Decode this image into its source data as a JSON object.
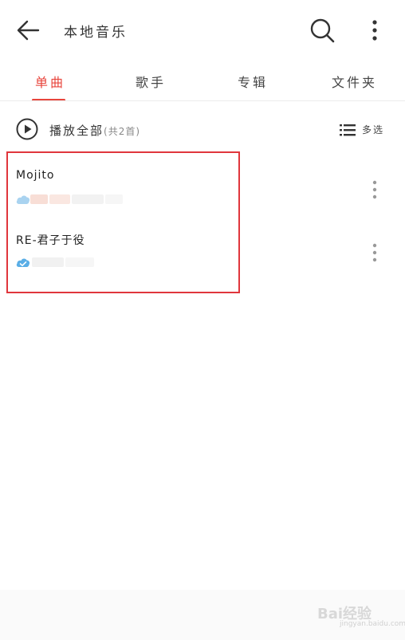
{
  "header": {
    "title": "本地音乐",
    "back_icon": "arrow-left-icon",
    "search_icon": "search-icon",
    "more_icon": "vertical-dots-icon"
  },
  "tabs": [
    {
      "label": "单曲",
      "active": true
    },
    {
      "label": "歌手",
      "active": false
    },
    {
      "label": "专辑",
      "active": false
    },
    {
      "label": "文件夹",
      "active": false
    }
  ],
  "playall": {
    "label": "播放全部",
    "count": "(共2首)",
    "multi_select_label": "多选"
  },
  "songs": [
    {
      "title": "Mojito"
    },
    {
      "title": "RE-君子于役"
    }
  ],
  "colors": {
    "accent": "#e8453c",
    "highlight_border": "#e0363c",
    "cloud": "#5aaee6"
  },
  "watermark": {
    "text": "Bai经验",
    "sub": "jingyan.baidu.com"
  }
}
